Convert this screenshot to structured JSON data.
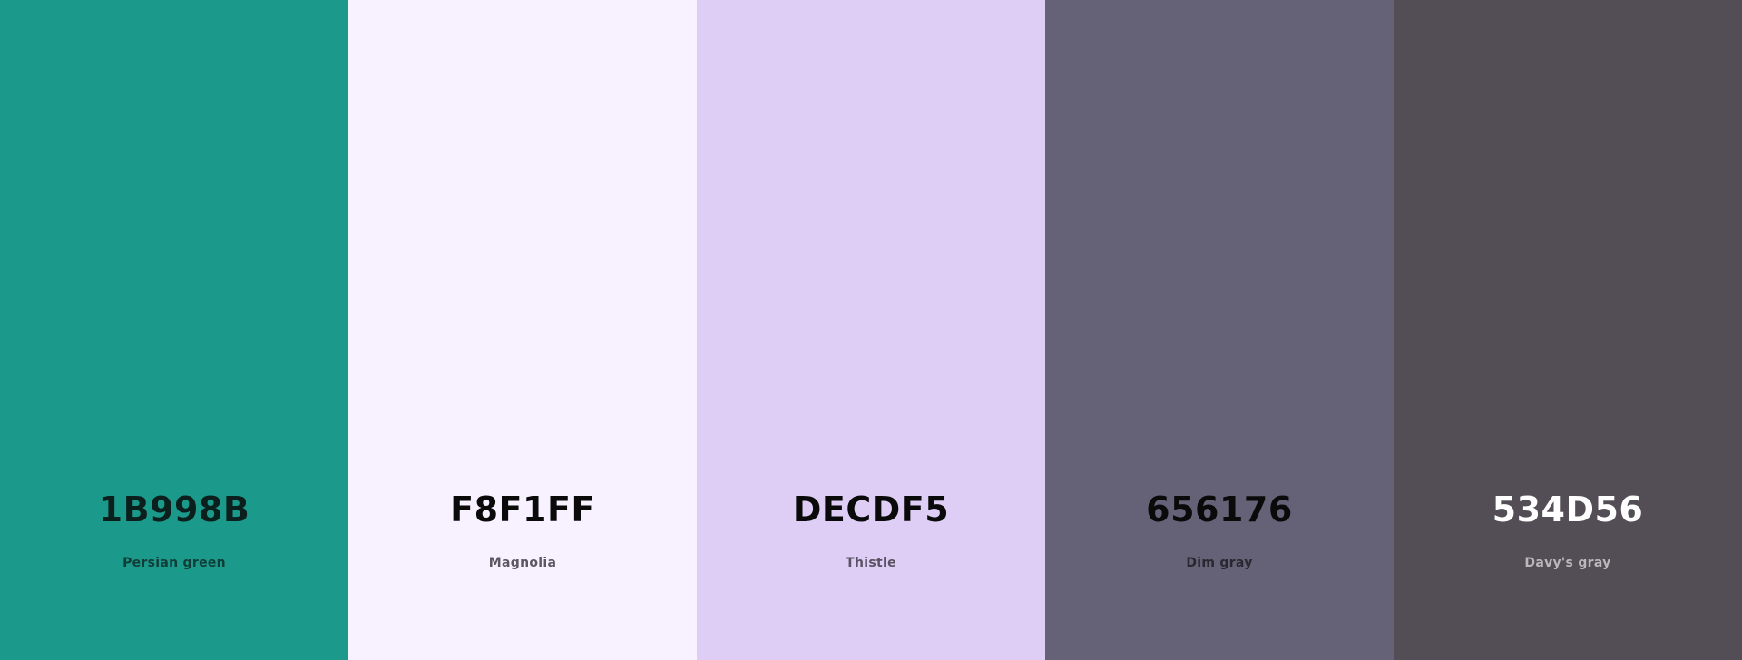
{
  "palette": {
    "swatches": [
      {
        "hex": "1B998B",
        "name": "Persian green",
        "color": "#1B998B",
        "hex_text_color": "#0b1f1c",
        "name_text_color": "#103d37"
      },
      {
        "hex": "F8F1FF",
        "name": "Magnolia",
        "color": "#F8F1FF",
        "hex_text_color": "#0a0a0a",
        "name_text_color": "#5c5860"
      },
      {
        "hex": "DECDF5",
        "name": "Thistle",
        "color": "#DECDF5",
        "hex_text_color": "#0a0a0a",
        "name_text_color": "#595262"
      },
      {
        "hex": "656176",
        "name": "Dim gray",
        "color": "#656176",
        "hex_text_color": "#0a0a0a",
        "name_text_color": "#29272f"
      },
      {
        "hex": "534D56",
        "name": "Davy's gray",
        "color": "#534D56",
        "hex_text_color": "#ffffff",
        "name_text_color": "#bab8bb"
      }
    ]
  }
}
